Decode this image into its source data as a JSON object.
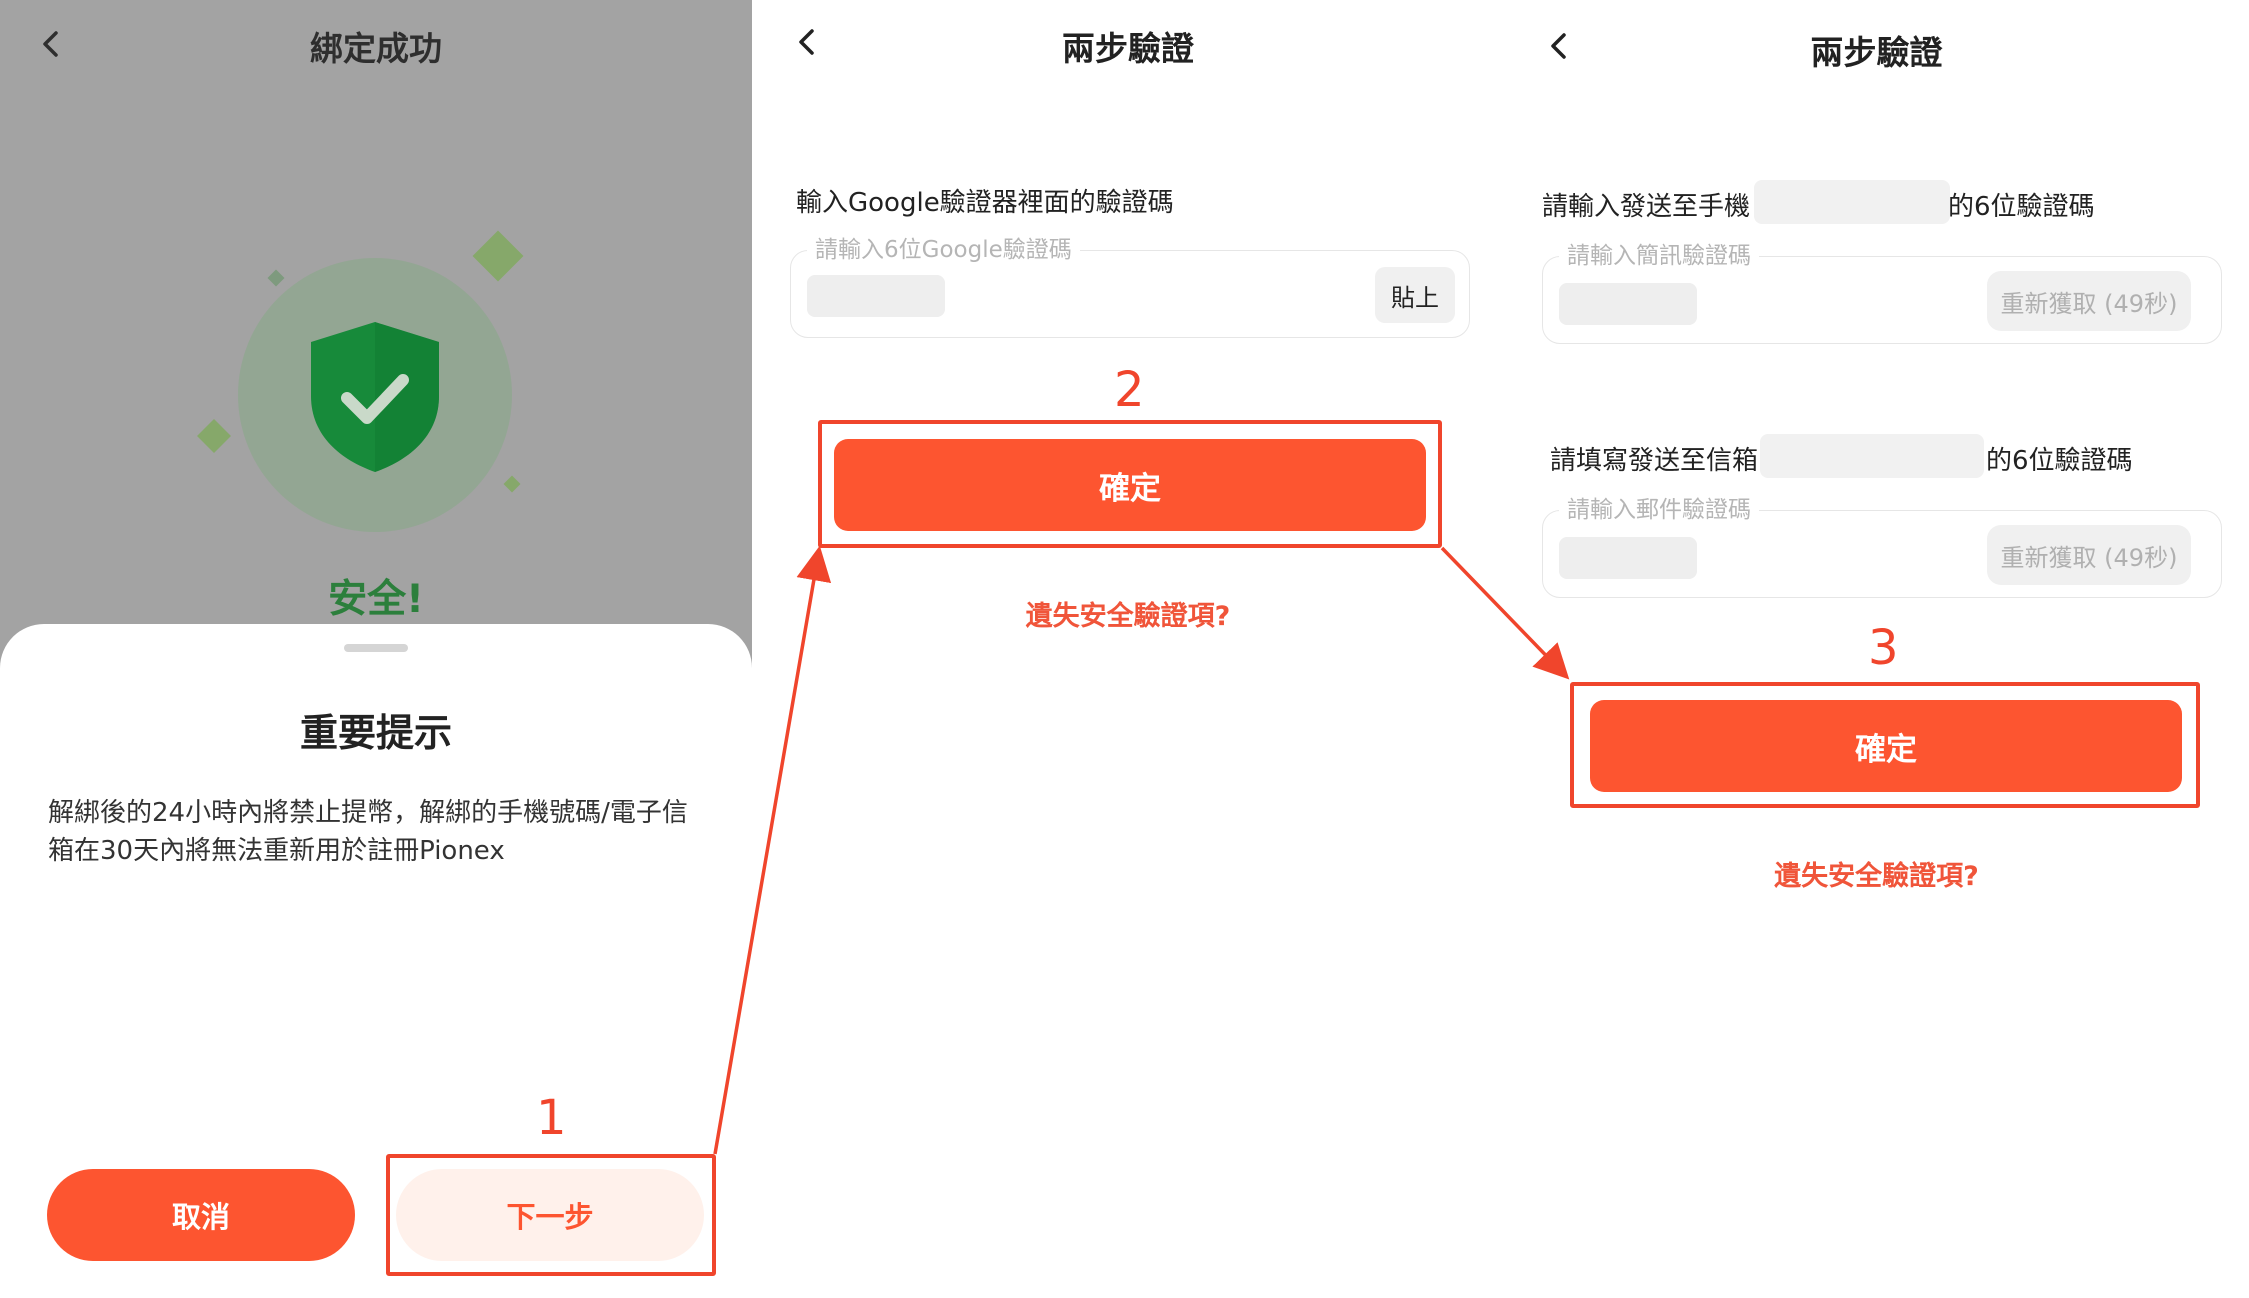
{
  "panel1": {
    "title": "綁定成功",
    "safe_text": "安全!",
    "sheet_title": "重要提示",
    "sheet_body": "解綁後的24小時內將禁止提幣，解綁的手機號碼/電子信箱在30天內將無法重新用於註冊Pionex",
    "cancel_label": "取消",
    "next_label": "下一步"
  },
  "panel2": {
    "title": "兩步驗證",
    "google_label": "輸入Google驗證器裡面的驗證碼",
    "google_placeholder": "請輸入6位Google驗證碼",
    "paste_label": "貼上",
    "confirm_label": "確定",
    "lost_link": "遺失安全驗證項?"
  },
  "panel3": {
    "title": "兩步驗證",
    "sms_label_prefix": "請輸入發送至手機",
    "sms_label_suffix": "的6位驗證碼",
    "sms_placeholder": "請輸入簡訊驗證碼",
    "sms_resend": "重新獲取 (49秒)",
    "email_label_prefix": "請填寫發送至信箱",
    "email_label_suffix": "的6位驗證碼",
    "email_placeholder": "請輸入郵件驗證碼",
    "email_resend": "重新獲取 (49秒)",
    "confirm_label": "確定",
    "lost_link": "遺失安全驗證項?"
  },
  "annotations": {
    "step1": "1",
    "step2": "2",
    "step3": "3"
  },
  "colors": {
    "accent": "#fd5530",
    "annotation": "#f0452c",
    "success_green": "#1e8a3a"
  }
}
